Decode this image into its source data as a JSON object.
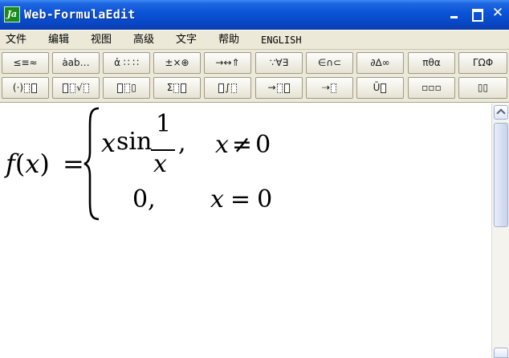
{
  "window": {
    "title": "Web-FormulaEdit",
    "logo_text": "Ja",
    "close_glyph": "✕"
  },
  "menu": {
    "items": [
      "文件",
      "编辑",
      "视图",
      "高级",
      "文字",
      "帮助",
      "ENGLISH"
    ]
  },
  "toolbar": {
    "row1": [
      "≤≡≈",
      "ȧab…",
      "ἀ ∷ ∷",
      "±×⊕",
      "→↔⇑",
      "∵∀∃",
      "∈∩⊂",
      "∂∆∞",
      "πθα",
      "ΓΩΦ"
    ],
    "row2_labels": [
      "(⋅)",
      "√",
      "▯",
      "Σ",
      "∫",
      "→",
      "⇢",
      "Ū",
      "▫▫▫",
      "▯▯"
    ]
  },
  "formula": {
    "lhs_func": "f",
    "lhs_open": "(",
    "lhs_var": "x",
    "lhs_close": ")",
    "equals": "=",
    "row1": {
      "x": "x",
      "sin": "sin",
      "numerator": "1",
      "denominator": "x",
      "comma": ",",
      "cond_var": "x",
      "cond_op": "≠",
      "cond_val": "0"
    },
    "row2": {
      "value": "0,",
      "cond_var": "x",
      "cond_op": "=",
      "cond_val": "0"
    }
  }
}
